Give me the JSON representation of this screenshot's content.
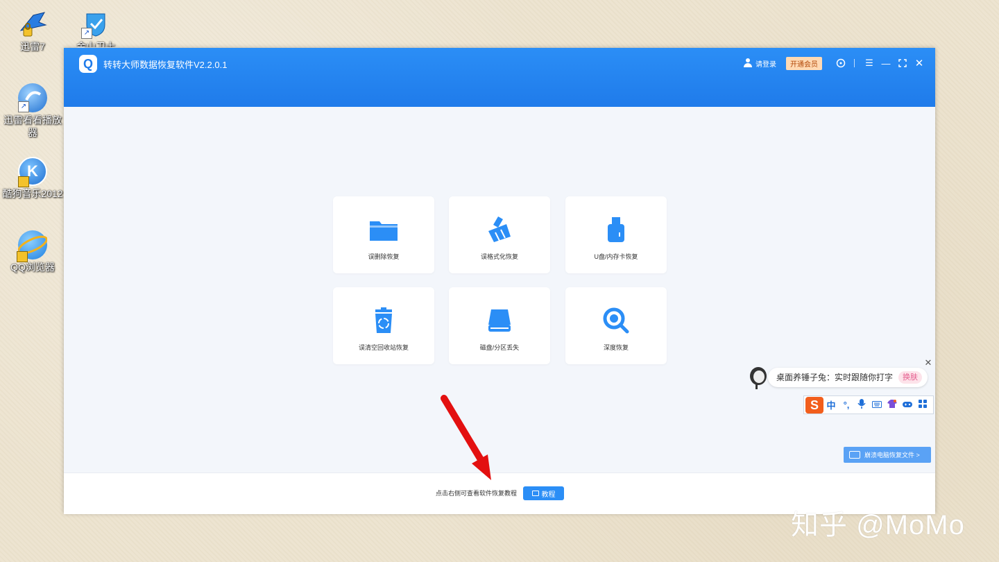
{
  "desktop": {
    "icons": [
      {
        "label": "迅雷7"
      },
      {
        "label": "金山卫士"
      },
      {
        "label": "迅雷看看播放器"
      },
      {
        "label": "酷狗音乐2012"
      },
      {
        "label": "QQ浏览器"
      }
    ]
  },
  "window": {
    "title": "转转大师数据恢复软件V2.2.0.1",
    "login_label": "请登录",
    "vip_label": "开通会员"
  },
  "cards": [
    {
      "label": "误删除恢复",
      "icon": "folder-icon"
    },
    {
      "label": "误格式化恢复",
      "icon": "broom-icon"
    },
    {
      "label": "U盘/内存卡恢复",
      "icon": "usb-drive-icon"
    },
    {
      "label": "误清空回收站恢复",
      "icon": "recycle-bin-icon"
    },
    {
      "label": "磁盘/分区丢失",
      "icon": "hard-disk-icon"
    },
    {
      "label": "深度恢复",
      "icon": "deep-scan-icon"
    }
  ],
  "bottom": {
    "hint": "点击右侧可查看软件恢复教程",
    "tutorial_label": "教程"
  },
  "side_link": {
    "label": "崩溃电脑恢复文件 >"
  },
  "ime": {
    "tip_text": "桌面养锤子兔：实时跟随你打字",
    "skin_label": "换肤",
    "logo": "S",
    "items": [
      "中",
      "°,"
    ]
  },
  "watermark": "知乎 @MoMo",
  "colors": {
    "brand_blue": "#2b8ef6",
    "vip_bg": "#ffd9b3",
    "ime_orange": "#f25e1c",
    "arrow_red": "#e31010"
  }
}
